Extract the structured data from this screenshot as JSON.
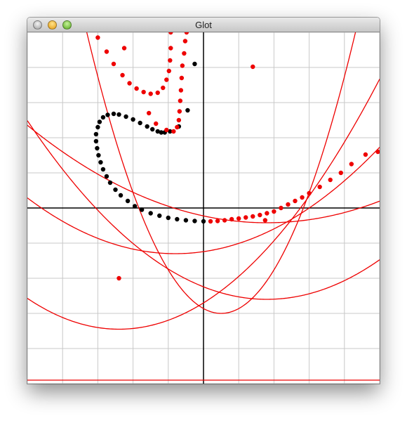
{
  "window": {
    "title": "Glot",
    "buttons": {
      "close": "close-button",
      "minimize": "minimize-button",
      "zoom": "zoom-button"
    }
  },
  "colors": {
    "grid": "#c8c8c8",
    "axis": "#000000",
    "curve": "#ee0000",
    "black_points": "#000000",
    "red_points": "#ee0000"
  },
  "chart_data": {
    "type": "scatter",
    "grid": true,
    "xlim": [
      -5,
      5
    ],
    "ylim": [
      -5,
      5
    ],
    "black_points": [
      [
        -3.0,
        2.3
      ],
      [
        -2.95,
        2.45
      ],
      [
        -2.85,
        2.58
      ],
      [
        -2.72,
        2.65
      ],
      [
        -2.55,
        2.68
      ],
      [
        -2.4,
        2.66
      ],
      [
        -2.2,
        2.6
      ],
      [
        -2.0,
        2.52
      ],
      [
        -1.8,
        2.42
      ],
      [
        -1.6,
        2.32
      ],
      [
        -1.45,
        2.24
      ],
      [
        -1.3,
        2.18
      ],
      [
        -1.2,
        2.15
      ],
      [
        -1.1,
        2.15
      ],
      [
        -0.95,
        2.18
      ],
      [
        -0.7,
        2.32
      ],
      [
        -0.45,
        2.78
      ],
      [
        -0.25,
        4.1
      ],
      [
        -3.05,
        2.1
      ],
      [
        -3.05,
        1.9
      ],
      [
        -3.02,
        1.7
      ],
      [
        -2.98,
        1.5
      ],
      [
        -2.92,
        1.3
      ],
      [
        -2.85,
        1.1
      ],
      [
        -2.75,
        0.9
      ],
      [
        -2.65,
        0.72
      ],
      [
        -2.5,
        0.52
      ],
      [
        -2.35,
        0.36
      ],
      [
        -2.15,
        0.2
      ],
      [
        -1.95,
        0.05
      ],
      [
        -1.75,
        -0.05
      ],
      [
        -1.5,
        -0.15
      ],
      [
        -1.25,
        -0.22
      ],
      [
        -1.0,
        -0.28
      ],
      [
        -0.75,
        -0.32
      ],
      [
        -0.5,
        -0.35
      ],
      [
        -0.25,
        -0.37
      ],
      [
        0.0,
        -0.38
      ]
    ],
    "red_points": [
      [
        -3.0,
        4.85
      ],
      [
        -2.75,
        4.45
      ],
      [
        -2.55,
        4.1
      ],
      [
        -2.3,
        3.78
      ],
      [
        -2.1,
        3.55
      ],
      [
        -1.9,
        3.4
      ],
      [
        -1.7,
        3.3
      ],
      [
        -1.5,
        3.25
      ],
      [
        -1.3,
        3.28
      ],
      [
        -1.15,
        3.42
      ],
      [
        -1.05,
        3.65
      ],
      [
        -0.98,
        3.9
      ],
      [
        -0.95,
        4.2
      ],
      [
        -0.93,
        4.55
      ],
      [
        -0.93,
        5.0
      ],
      [
        -2.25,
        4.55
      ],
      [
        -1.55,
        2.7
      ],
      [
        -1.35,
        2.4
      ],
      [
        -1.05,
        2.22
      ],
      [
        -0.85,
        2.18
      ],
      [
        -0.75,
        2.3
      ],
      [
        -0.7,
        2.5
      ],
      [
        -0.68,
        2.75
      ],
      [
        -0.66,
        3.05
      ],
      [
        -0.64,
        3.35
      ],
      [
        -0.62,
        3.7
      ],
      [
        -0.6,
        4.05
      ],
      [
        -0.55,
        4.4
      ],
      [
        -0.52,
        4.75
      ],
      [
        -0.48,
        5.0
      ],
      [
        1.4,
        4.02
      ],
      [
        -2.4,
        -2.0
      ],
      [
        1.75,
        -0.35
      ],
      [
        0.2,
        -0.38
      ],
      [
        0.4,
        -0.37
      ],
      [
        0.6,
        -0.35
      ],
      [
        0.8,
        -0.32
      ],
      [
        1.0,
        -0.3
      ],
      [
        1.2,
        -0.27
      ],
      [
        1.4,
        -0.24
      ],
      [
        1.6,
        -0.2
      ],
      [
        1.8,
        -0.15
      ],
      [
        2.0,
        -0.1
      ],
      [
        2.2,
        0.0
      ],
      [
        2.4,
        0.1
      ],
      [
        2.6,
        0.2
      ],
      [
        2.8,
        0.3
      ],
      [
        3.0,
        0.42
      ],
      [
        3.3,
        0.6
      ],
      [
        3.6,
        0.8
      ],
      [
        3.9,
        1.0
      ],
      [
        4.2,
        1.25
      ],
      [
        4.6,
        1.52
      ],
      [
        4.95,
        1.6
      ]
    ],
    "curves": [
      {
        "a": 0.06,
        "h": 1.8,
        "k": -0.42
      },
      {
        "a": 0.09,
        "h": -0.8,
        "k": -1.3
      },
      {
        "a": 0.11,
        "h": 1.8,
        "k": -2.6
      },
      {
        "a": 0.13,
        "h": -2.4,
        "k": -3.45
      },
      {
        "a": 0.55,
        "h": 0.5,
        "k": -3.0
      }
    ],
    "hline_y": -4.9
  }
}
